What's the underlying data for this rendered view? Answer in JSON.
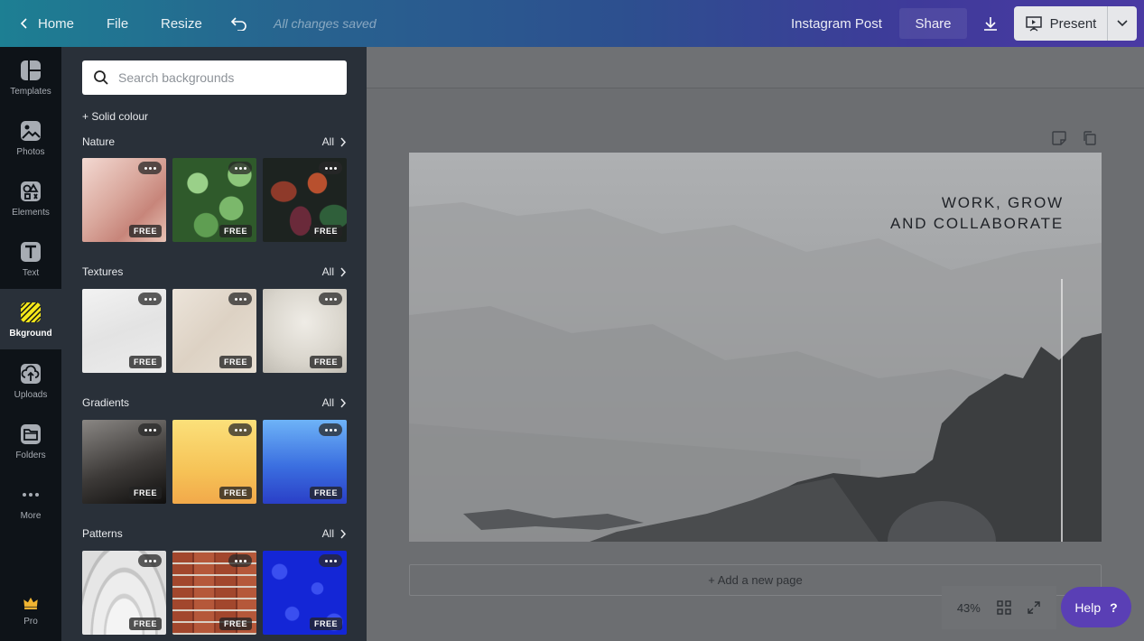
{
  "topbar": {
    "home": "Home",
    "file": "File",
    "resize": "Resize",
    "saved": "All changes saved",
    "doc_type": "Instagram Post",
    "share": "Share",
    "present": "Present"
  },
  "nav": {
    "items": [
      {
        "label": "Templates",
        "icon": "templates-icon"
      },
      {
        "label": "Photos",
        "icon": "photos-icon"
      },
      {
        "label": "Elements",
        "icon": "elements-icon"
      },
      {
        "label": "Text",
        "icon": "text-icon"
      },
      {
        "label": "Bkground",
        "icon": "background-icon",
        "active": true
      },
      {
        "label": "Uploads",
        "icon": "uploads-icon"
      },
      {
        "label": "Folders",
        "icon": "folders-icon"
      },
      {
        "label": "More",
        "icon": "more-icon"
      },
      {
        "label": "Pro",
        "icon": "crown-icon"
      }
    ]
  },
  "panel": {
    "search_placeholder": "Search backgrounds",
    "solid_colour": "+ Solid colour",
    "all_label": "All",
    "free_badge": "FREE",
    "sections": [
      {
        "title": "Nature",
        "thumbs": [
          "pink-field",
          "green-leaves",
          "dark-croton-leaves"
        ]
      },
      {
        "title": "Textures",
        "thumbs": [
          "white-marble",
          "beige-concrete",
          "grey-plaster"
        ]
      },
      {
        "title": "Gradients",
        "thumbs": [
          "grey-black-gradient",
          "yellow-orange-gradient",
          "blue-gradient"
        ]
      },
      {
        "title": "Patterns",
        "thumbs": [
          "white-arches",
          "red-brick",
          "blue-leaf-pattern"
        ]
      }
    ]
  },
  "canvas": {
    "title_line1": "WORK, GROW",
    "title_line2": "AND COLLABORATE",
    "add_page": "+ Add a new page",
    "zoom": "43%",
    "help": "Help",
    "help_mark": "?"
  },
  "colors": {
    "accent": "#5a3fb5",
    "active_nav_icon": "#f5e71a"
  }
}
